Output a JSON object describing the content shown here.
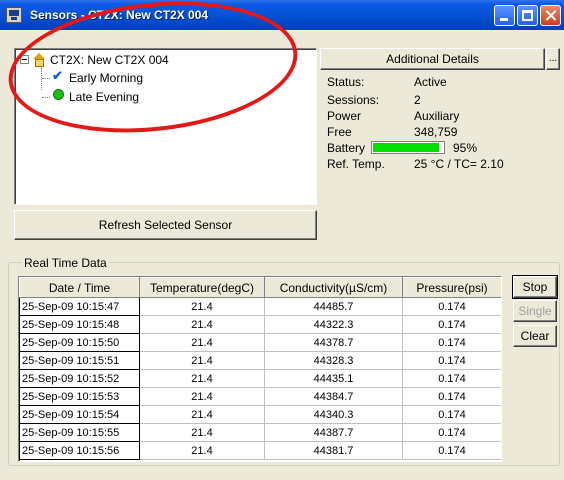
{
  "window": {
    "title": "Sensors - CT2X: New CT2X 004"
  },
  "tree": {
    "root": "CT2X: New CT2X 004",
    "children": [
      "Early Morning",
      "Late Evening"
    ]
  },
  "refresh_label": "Refresh Selected Sensor",
  "details": {
    "button_label": "Additional Details",
    "more_label": "...",
    "rows": [
      {
        "label": "Status:",
        "value": "Active"
      },
      {
        "label": "Sessions:",
        "value": "2"
      },
      {
        "label": "Power",
        "value": "Auxiliary"
      },
      {
        "label": "Free",
        "value": "348,759"
      },
      {
        "label": "Battery",
        "value": ""
      },
      {
        "label": "Ref. Temp.",
        "value": "25 °C / TC= 2.10"
      }
    ],
    "battery_percent": 95,
    "battery_text": "95%",
    "battery_color": "#00e000"
  },
  "realtime": {
    "group_label": "Real Time Data",
    "columns": [
      "Date / Time",
      "Temperature(degC)",
      "Conductivity(µS/cm)",
      "Pressure(psi)"
    ],
    "rows": [
      [
        "25-Sep-09 10:15:47",
        "21.4",
        "44485.7",
        "0.174"
      ],
      [
        "25-Sep-09 10:15:48",
        "21.4",
        "44322.3",
        "0.174"
      ],
      [
        "25-Sep-09 10:15:50",
        "21.4",
        "44378.7",
        "0.174"
      ],
      [
        "25-Sep-09 10:15:51",
        "21.4",
        "44328.3",
        "0.174"
      ],
      [
        "25-Sep-09 10:15:52",
        "21.4",
        "44435.1",
        "0.174"
      ],
      [
        "25-Sep-09 10:15:53",
        "21.4",
        "44384.7",
        "0.174"
      ],
      [
        "25-Sep-09 10:15:54",
        "21.4",
        "44340.3",
        "0.174"
      ],
      [
        "25-Sep-09 10:15:55",
        "21.4",
        "44387.7",
        "0.174"
      ],
      [
        "25-Sep-09 10:15:56",
        "21.4",
        "44381.7",
        "0.174"
      ]
    ],
    "buttons": {
      "stop": "Stop",
      "single": "Single",
      "clear": "Clear"
    }
  },
  "annotation_color": "#e51818"
}
